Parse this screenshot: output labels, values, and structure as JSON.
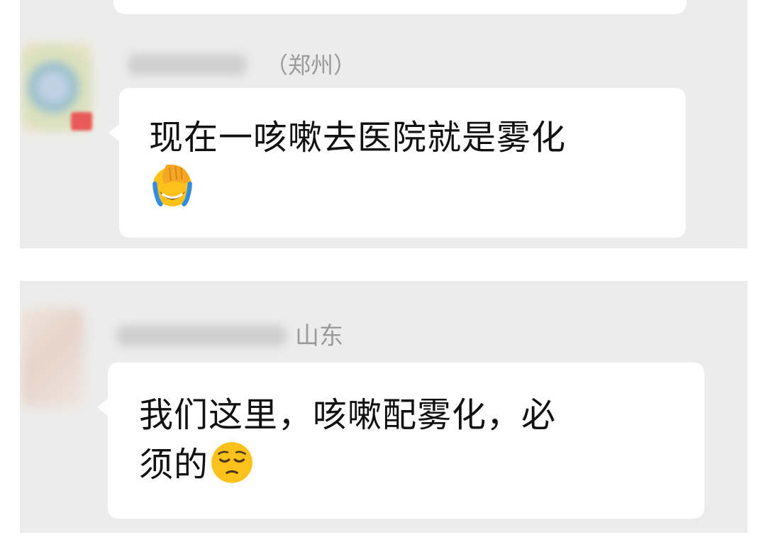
{
  "messages": [
    {
      "sender_region": "（郑州）",
      "text": "现在一咳嗽去医院就是雾化",
      "emoji": "face-palm-crying-emoji"
    },
    {
      "sender_region": "山东",
      "text_line1": "我们这里，咳嗽配雾化，必",
      "text_line2": "须的",
      "emoji": "pensive-face-emoji"
    }
  ],
  "colors": {
    "chat_background": "#ececec",
    "bubble": "#ffffff",
    "sender_name": "#9a9a9a",
    "accent_green": "#6ad17a"
  }
}
